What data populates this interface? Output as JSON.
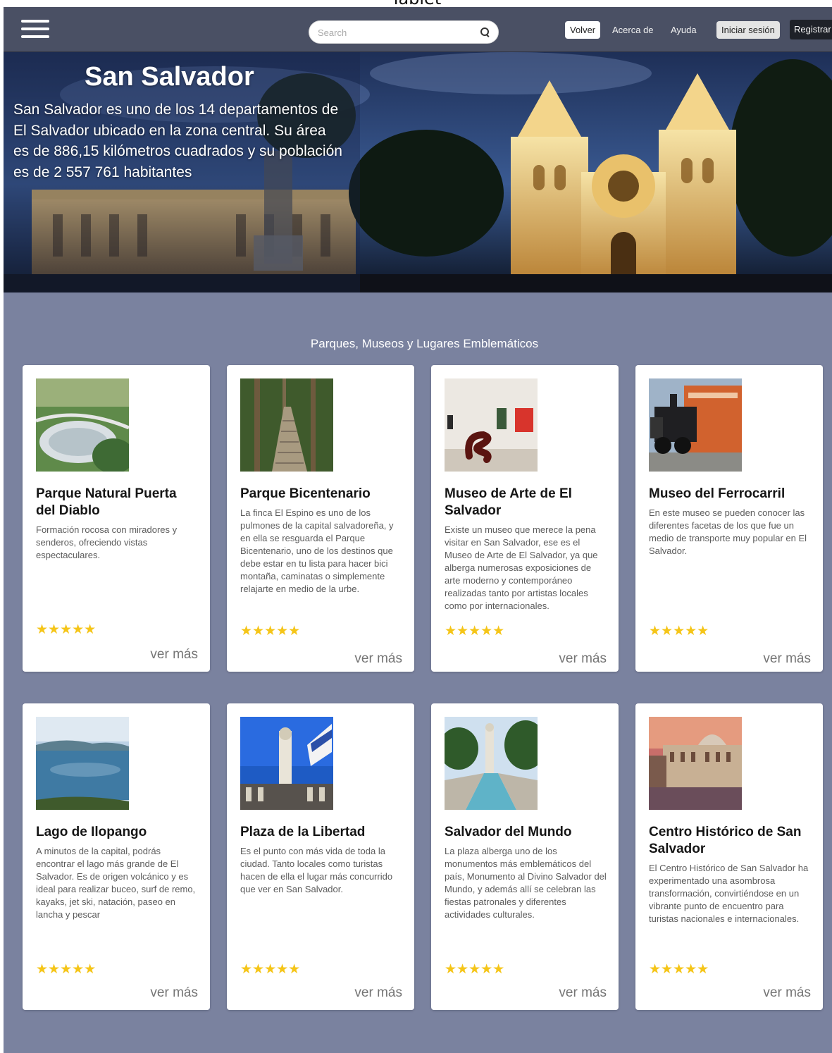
{
  "top_caption": "Tablet",
  "header": {
    "search_placeholder": "Search",
    "volver": "Volver",
    "acerca": "Acerca de",
    "ayuda": "Ayuda",
    "login": "Iniciar sesión",
    "register": "Registrar"
  },
  "hero": {
    "title": "San Salvador",
    "text": "San Salvador es uno de los 14 departamentos de El Salvador ubicado en la zona central. Su área es de 886,15 kilómetros cuadrados y su población es de 2 557 761 habitantes"
  },
  "section_title": "Parques, Museos y Lugares Emblemáticos",
  "ver_mas": "ver más",
  "cards": [
    {
      "title": "Parque Natural Puerta del Diablo",
      "desc": "Formación rocosa con miradores y senderos, ofreciendo vistas espectaculares.",
      "rating": 5,
      "stars": "★★★★★"
    },
    {
      "title": "Parque Bicentenario",
      "desc": "La finca El Espino es uno de los pulmones de la capital salvadoreña, y en ella se resguarda el Parque Bicentenario, uno de los destinos que debe estar en tu lista para hacer bici montaña, caminatas o simplemente relajarte en medio de la urbe.",
      "rating": 5,
      "stars": "★★★★★"
    },
    {
      "title": "Museo de Arte de El Salvador",
      "desc": "Existe un museo que merece la pena visitar en San Salvador, ese es el Museo de Arte de El Salvador, ya que alberga numerosas exposiciones de arte moderno y contemporáneo realizadas tanto por artistas locales como por internacionales.",
      "rating": 5,
      "stars": "★★★★★"
    },
    {
      "title": "Museo del Ferrocarril",
      "desc": "En este museo se pueden conocer las diferentes facetas de los que fue un medio de transporte muy popular en El Salvador.",
      "rating": 5,
      "stars": "★★★★★"
    },
    {
      "title": "Lago de Ilopango",
      "desc": "A minutos de la capital, podrás encontrar el lago más grande de El Salvador. Es de origen volcánico y es ideal para realizar buceo, surf de remo, kayaks, jet ski, natación, paseo en lancha y pescar",
      "rating": 5,
      "stars": "★★★★★"
    },
    {
      "title": "Plaza de la Libertad",
      "desc": "Es el punto con más vida de toda la ciudad. Tanto locales como turistas hacen de ella el lugar más concurrido que ver en San Salvador.",
      "rating": 5,
      "stars": "★★★★★"
    },
    {
      "title": "Salvador del Mundo",
      "desc": "La plaza alberga uno de los monumentos más emblemáticos del país, Monumento al Divino Salvador del Mundo, y además allí se celebran las fiestas patronales y diferentes actividades culturales.",
      "rating": 5,
      "stars": "★★★★★"
    },
    {
      "title": "Centro Histórico de San Salvador",
      "desc": "El Centro Histórico de San Salvador ha experimentado una asombrosa transformación, convirtiéndose en un vibrante punto de encuentro para turistas nacionales e internacionales.",
      "rating": 5,
      "stars": "★★★★★"
    }
  ]
}
